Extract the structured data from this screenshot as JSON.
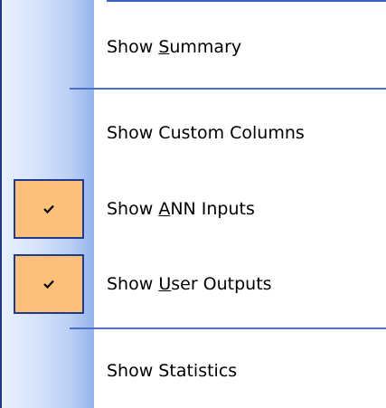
{
  "menu": {
    "items": [
      {
        "pre": "Show ",
        "mnemonic": "S",
        "post": "ummary",
        "checked": false
      },
      {
        "pre": "Show Custom Columns",
        "mnemonic": "",
        "post": "",
        "checked": false
      },
      {
        "pre": "Show ",
        "mnemonic": "A",
        "post": "NN Inputs",
        "checked": true
      },
      {
        "pre": "Show ",
        "mnemonic": "U",
        "post": "ser Outputs",
        "checked": true
      },
      {
        "pre": "Show Statistics",
        "mnemonic": "",
        "post": "",
        "checked": false
      }
    ],
    "check_icon": "checkmark-icon"
  },
  "colors": {
    "checked_background": "#fdc07a",
    "checked_border": "#1f3a8f",
    "separator": "#4d6fcc",
    "gutter": "#b9cff5"
  }
}
